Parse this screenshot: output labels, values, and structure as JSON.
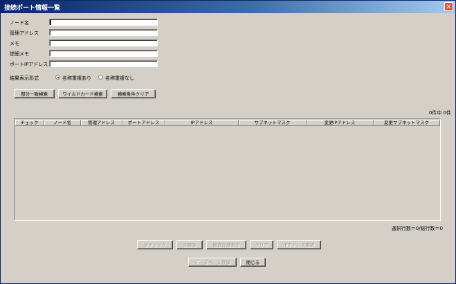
{
  "window": {
    "title": "接続ポート情報一覧",
    "close_label": "✕"
  },
  "form": {
    "node_name_label": "ノード名",
    "node_name_value": "",
    "mgmt_address_label": "管理アドレス",
    "mgmt_address_value": "",
    "memo_label": "メモ",
    "memo_value": "",
    "detail_memo_label": "詳細メモ",
    "detail_memo_value": "",
    "port_ip_label": "ポートIPアドレス",
    "port_ip_value": ""
  },
  "display_format": {
    "label": "結果表示形式",
    "options": [
      "名称重複あり",
      "名称重複なし"
    ],
    "selected": "名称重複あり"
  },
  "search_buttons": {
    "partial": "部分一致検索",
    "wildcard": "ワイルドカード検索",
    "clear": "検索条件クリア"
  },
  "result_count": "0件中 0件",
  "table": {
    "columns": [
      "チェック",
      "ノード名",
      "管理アドレス",
      "ポートアドレス",
      "IPアドレス",
      "サブネットマスク",
      "変更IPアドレス",
      "変更サブネットマスク"
    ],
    "rows": []
  },
  "selection_status": "選択行数＝0/総行数＝0",
  "action_buttons": {
    "all_check": "全チェック",
    "all_uncheck": "全解除",
    "show_details": "機器詳細表示",
    "clear": "クリア",
    "ip_select": "IPアドレス選択"
  },
  "footer_buttons": {
    "db_register": "データベース登録",
    "close": "閉じる"
  }
}
